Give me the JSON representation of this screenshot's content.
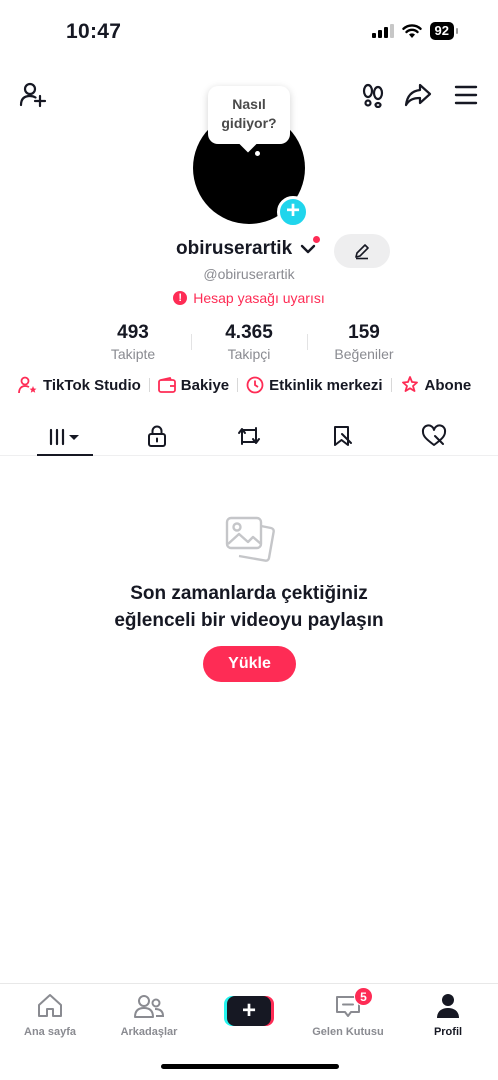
{
  "status_bar": {
    "time": "10:47",
    "battery": "92"
  },
  "profile": {
    "bubble_line1": "Nasıl",
    "bubble_line2": "gidiyor?",
    "username": "obiruserartik",
    "handle": "@obiruserartik",
    "warning": "Hesap yasağı uyarısı"
  },
  "stats": [
    {
      "value": "493",
      "label": "Takipte"
    },
    {
      "value": "4.365",
      "label": "Takipçi"
    },
    {
      "value": "159",
      "label": "Beğeniler"
    }
  ],
  "quick_links": [
    {
      "label": "TikTok Studio",
      "icon": "person-star-icon"
    },
    {
      "label": "Bakiye",
      "icon": "wallet-icon"
    },
    {
      "label": "Etkinlik merkezi",
      "icon": "clock-icon"
    },
    {
      "label": "Abone",
      "icon": "star-hand-icon"
    }
  ],
  "tabs": [
    "videos-grid-icon",
    "lock-icon",
    "repost-icon",
    "bookmark-icon",
    "liked-icon"
  ],
  "empty_state": {
    "line1": "Son zamanlarda çektiğiniz",
    "line2": "eğlenceli bir videoyu paylaşın",
    "button": "Yükle"
  },
  "bottom_nav": [
    {
      "label": "Ana sayfa",
      "icon": "home-icon"
    },
    {
      "label": "Arkadaşlar",
      "icon": "friends-icon"
    },
    {
      "label": "",
      "icon": "create-plus-icon"
    },
    {
      "label": "Gelen Kutusu",
      "icon": "inbox-icon",
      "badge": "5"
    },
    {
      "label": "Profil",
      "icon": "profile-icon"
    }
  ],
  "colors": {
    "accent": "#fe2c55",
    "cyan": "#20d5ec",
    "text": "#161823",
    "muted": "#8a8b91"
  }
}
